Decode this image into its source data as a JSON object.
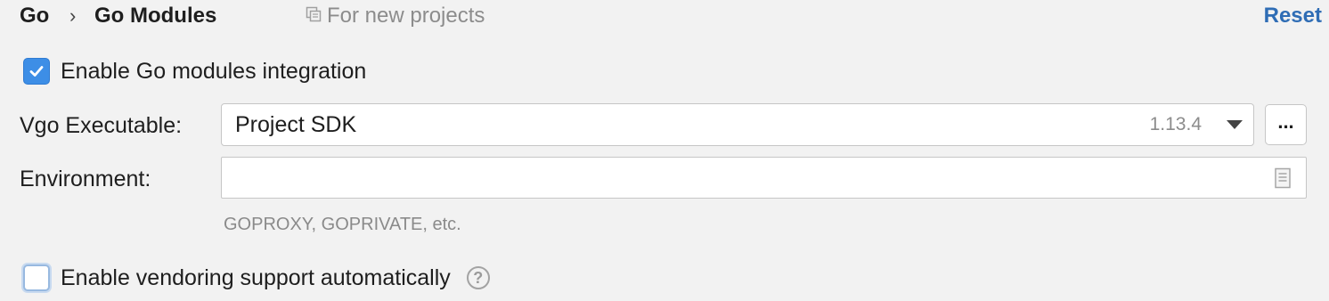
{
  "header": {
    "breadcrumb_root": "Go",
    "breadcrumb_separator": "›",
    "breadcrumb_page": "Go Modules",
    "scope_label": "For new projects",
    "scope_icon": "copy-icon",
    "reset_label": "Reset",
    "reset_color": "#2f6db5"
  },
  "settings": {
    "enable_modules": {
      "label": "Enable Go modules integration",
      "checked": true
    },
    "vgo_executable": {
      "label": "Vgo Executable:",
      "value": "Project SDK",
      "version": "1.13.4",
      "browse_label": "..."
    },
    "environment": {
      "label": "Environment:",
      "value": "",
      "hint": "GOPROXY, GOPRIVATE, etc.",
      "icon": "document-icon"
    },
    "enable_vendoring": {
      "label": "Enable vendoring support automatically",
      "checked": false,
      "help_icon": "?"
    }
  },
  "colors": {
    "accent": "#3d8ee6",
    "background": "#f2f2f2"
  }
}
